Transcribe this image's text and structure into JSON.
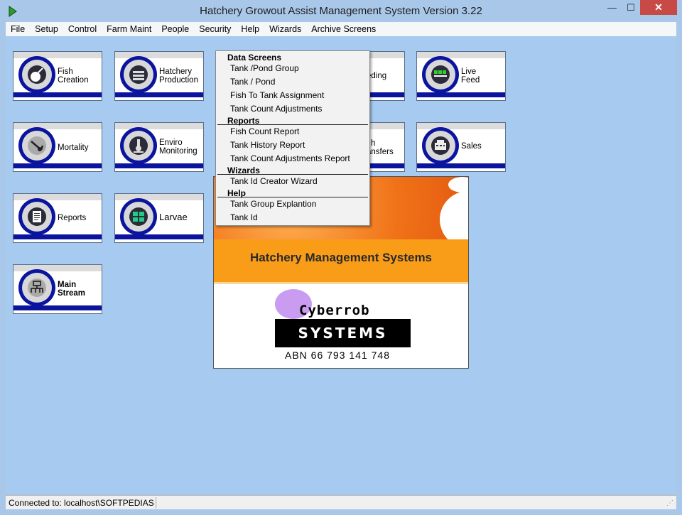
{
  "window": {
    "title": "Hatchery Growout Assist Management System Version 3.22",
    "minimize": "—",
    "maximize": "☐",
    "close": "✕"
  },
  "menubar": [
    "File",
    "Setup",
    "Control",
    "Farm Maint",
    "People",
    "Security",
    "Help",
    "Wizards",
    "Archive Screens"
  ],
  "tiles": {
    "fish_creation": [
      "Fish",
      "Creation"
    ],
    "hatchery_production": [
      "Hatchery",
      "Production"
    ],
    "feeding": "eding",
    "live_feed": [
      "Live",
      "Feed"
    ],
    "mortality": "Mortality",
    "enviro_monitoring": [
      "Enviro",
      "Monitoring"
    ],
    "transfers": [
      "h",
      "ansfers"
    ],
    "sales": "Sales",
    "reports": "Reports",
    "larvae": "Larvae",
    "main_stream": [
      "Main",
      "Stream"
    ]
  },
  "dropdown": {
    "sections": [
      {
        "header": "Data Screens",
        "items": [
          "Tank /Pond Group",
          "Tank / Pond",
          "Fish To Tank Assignment",
          "Tank Count Adjustments"
        ]
      },
      {
        "header": "Reports",
        "items": [
          "Fish Count Report",
          "Tank History Report",
          "Tank Count Adjustments Report"
        ]
      },
      {
        "header": "Wizards",
        "items": [
          "Tank Id Creator Wizard"
        ]
      },
      {
        "header": "Help",
        "items": [
          "Tank Group Explantion",
          "Tank Id"
        ]
      }
    ]
  },
  "splash": {
    "title": "Hatchery Management Systems",
    "company": "Cyberrob",
    "systems": "SYSTEMS",
    "abn": "ABN 66 793 141 748"
  },
  "status": {
    "connected": "Connected to: localhost\\SOFTPEDIAS"
  },
  "colors": {
    "background": "#a6caf0",
    "tile_band": "#0b149e",
    "splash_orange": "#f99d19",
    "close_button": "#c74a46"
  }
}
